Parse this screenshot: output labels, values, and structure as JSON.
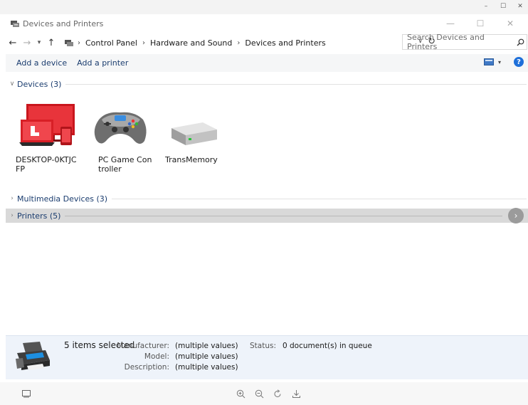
{
  "window": {
    "title": "Devices and Printers",
    "title_icon": "devices-printers-icon"
  },
  "navigation": {
    "back_icon": "back-arrow-icon",
    "forward_icon": "forward-arrow-icon",
    "recent_icon": "chevron-down-icon",
    "up_icon": "up-arrow-icon",
    "breadcrumbs": [
      "Control Panel",
      "Hardware and Sound",
      "Devices and Printers"
    ],
    "search_placeholder": "Search Devices and Printers"
  },
  "toolbar": {
    "add_device_label": "Add a device",
    "add_printer_label": "Add a printer"
  },
  "groups": {
    "devices": {
      "label": "Devices (3)",
      "expanded": true
    },
    "multimedia": {
      "label": "Multimedia Devices (3)",
      "expanded": false
    },
    "printers": {
      "label": "Printers (5)",
      "expanded": false,
      "selected": true
    }
  },
  "devices": [
    {
      "name": "DESKTOP-0KTJCFP",
      "icon": "laptop-desktop-icon"
    },
    {
      "name": "PC Game Controller",
      "icon": "game-controller-icon"
    },
    {
      "name": "TransMemory",
      "icon": "usb-drive-icon"
    }
  ],
  "details": {
    "selection": "5 items selected",
    "manufacturer_label": "Manufacturer:",
    "manufacturer_value": "(multiple values)",
    "model_label": "Model:",
    "model_value": "(multiple values)",
    "description_label": "Description:",
    "description_value": "(multiple values)",
    "status_label": "Status:",
    "status_value": "0 document(s) in queue"
  },
  "colors": {
    "accent_text": "#1a3c6e",
    "help": "#1e6fd9",
    "details_bg": "#eef3fa",
    "device_red": "#d81f26"
  }
}
